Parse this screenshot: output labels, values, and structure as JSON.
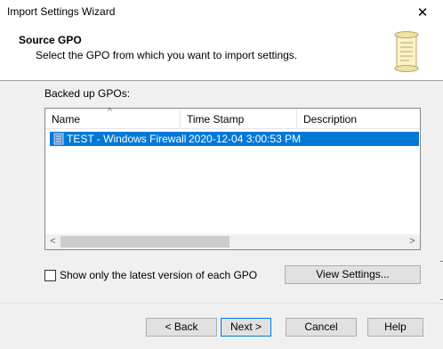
{
  "window": {
    "title": "Import Settings Wizard",
    "close_glyph": "✕"
  },
  "header": {
    "title": "Source GPO",
    "subtitle": "Select the GPO from which you want to import settings.",
    "icon": "scroll-icon"
  },
  "list": {
    "label": "Backed up GPOs:",
    "columns": [
      "Name",
      "Time Stamp",
      "Description"
    ],
    "sort_indicator": "^",
    "rows": [
      {
        "name": "TEST - Windows Firewall",
        "timestamp": "2020-12-04 3:00:53 PM",
        "description": "",
        "selected": true
      }
    ],
    "scroll_left": "<",
    "scroll_right": ">"
  },
  "options": {
    "latest_only_label": "Show only the latest version of each GPO",
    "latest_only_checked": false,
    "view_settings_label": "View Settings..."
  },
  "footer": {
    "back_label": "< Back",
    "next_label": "Next >",
    "cancel_label": "Cancel",
    "help_label": "Help"
  },
  "colors": {
    "selection": "#0078d7",
    "button_face": "#e1e1e1",
    "dialog_bg": "#f0f0f0"
  }
}
